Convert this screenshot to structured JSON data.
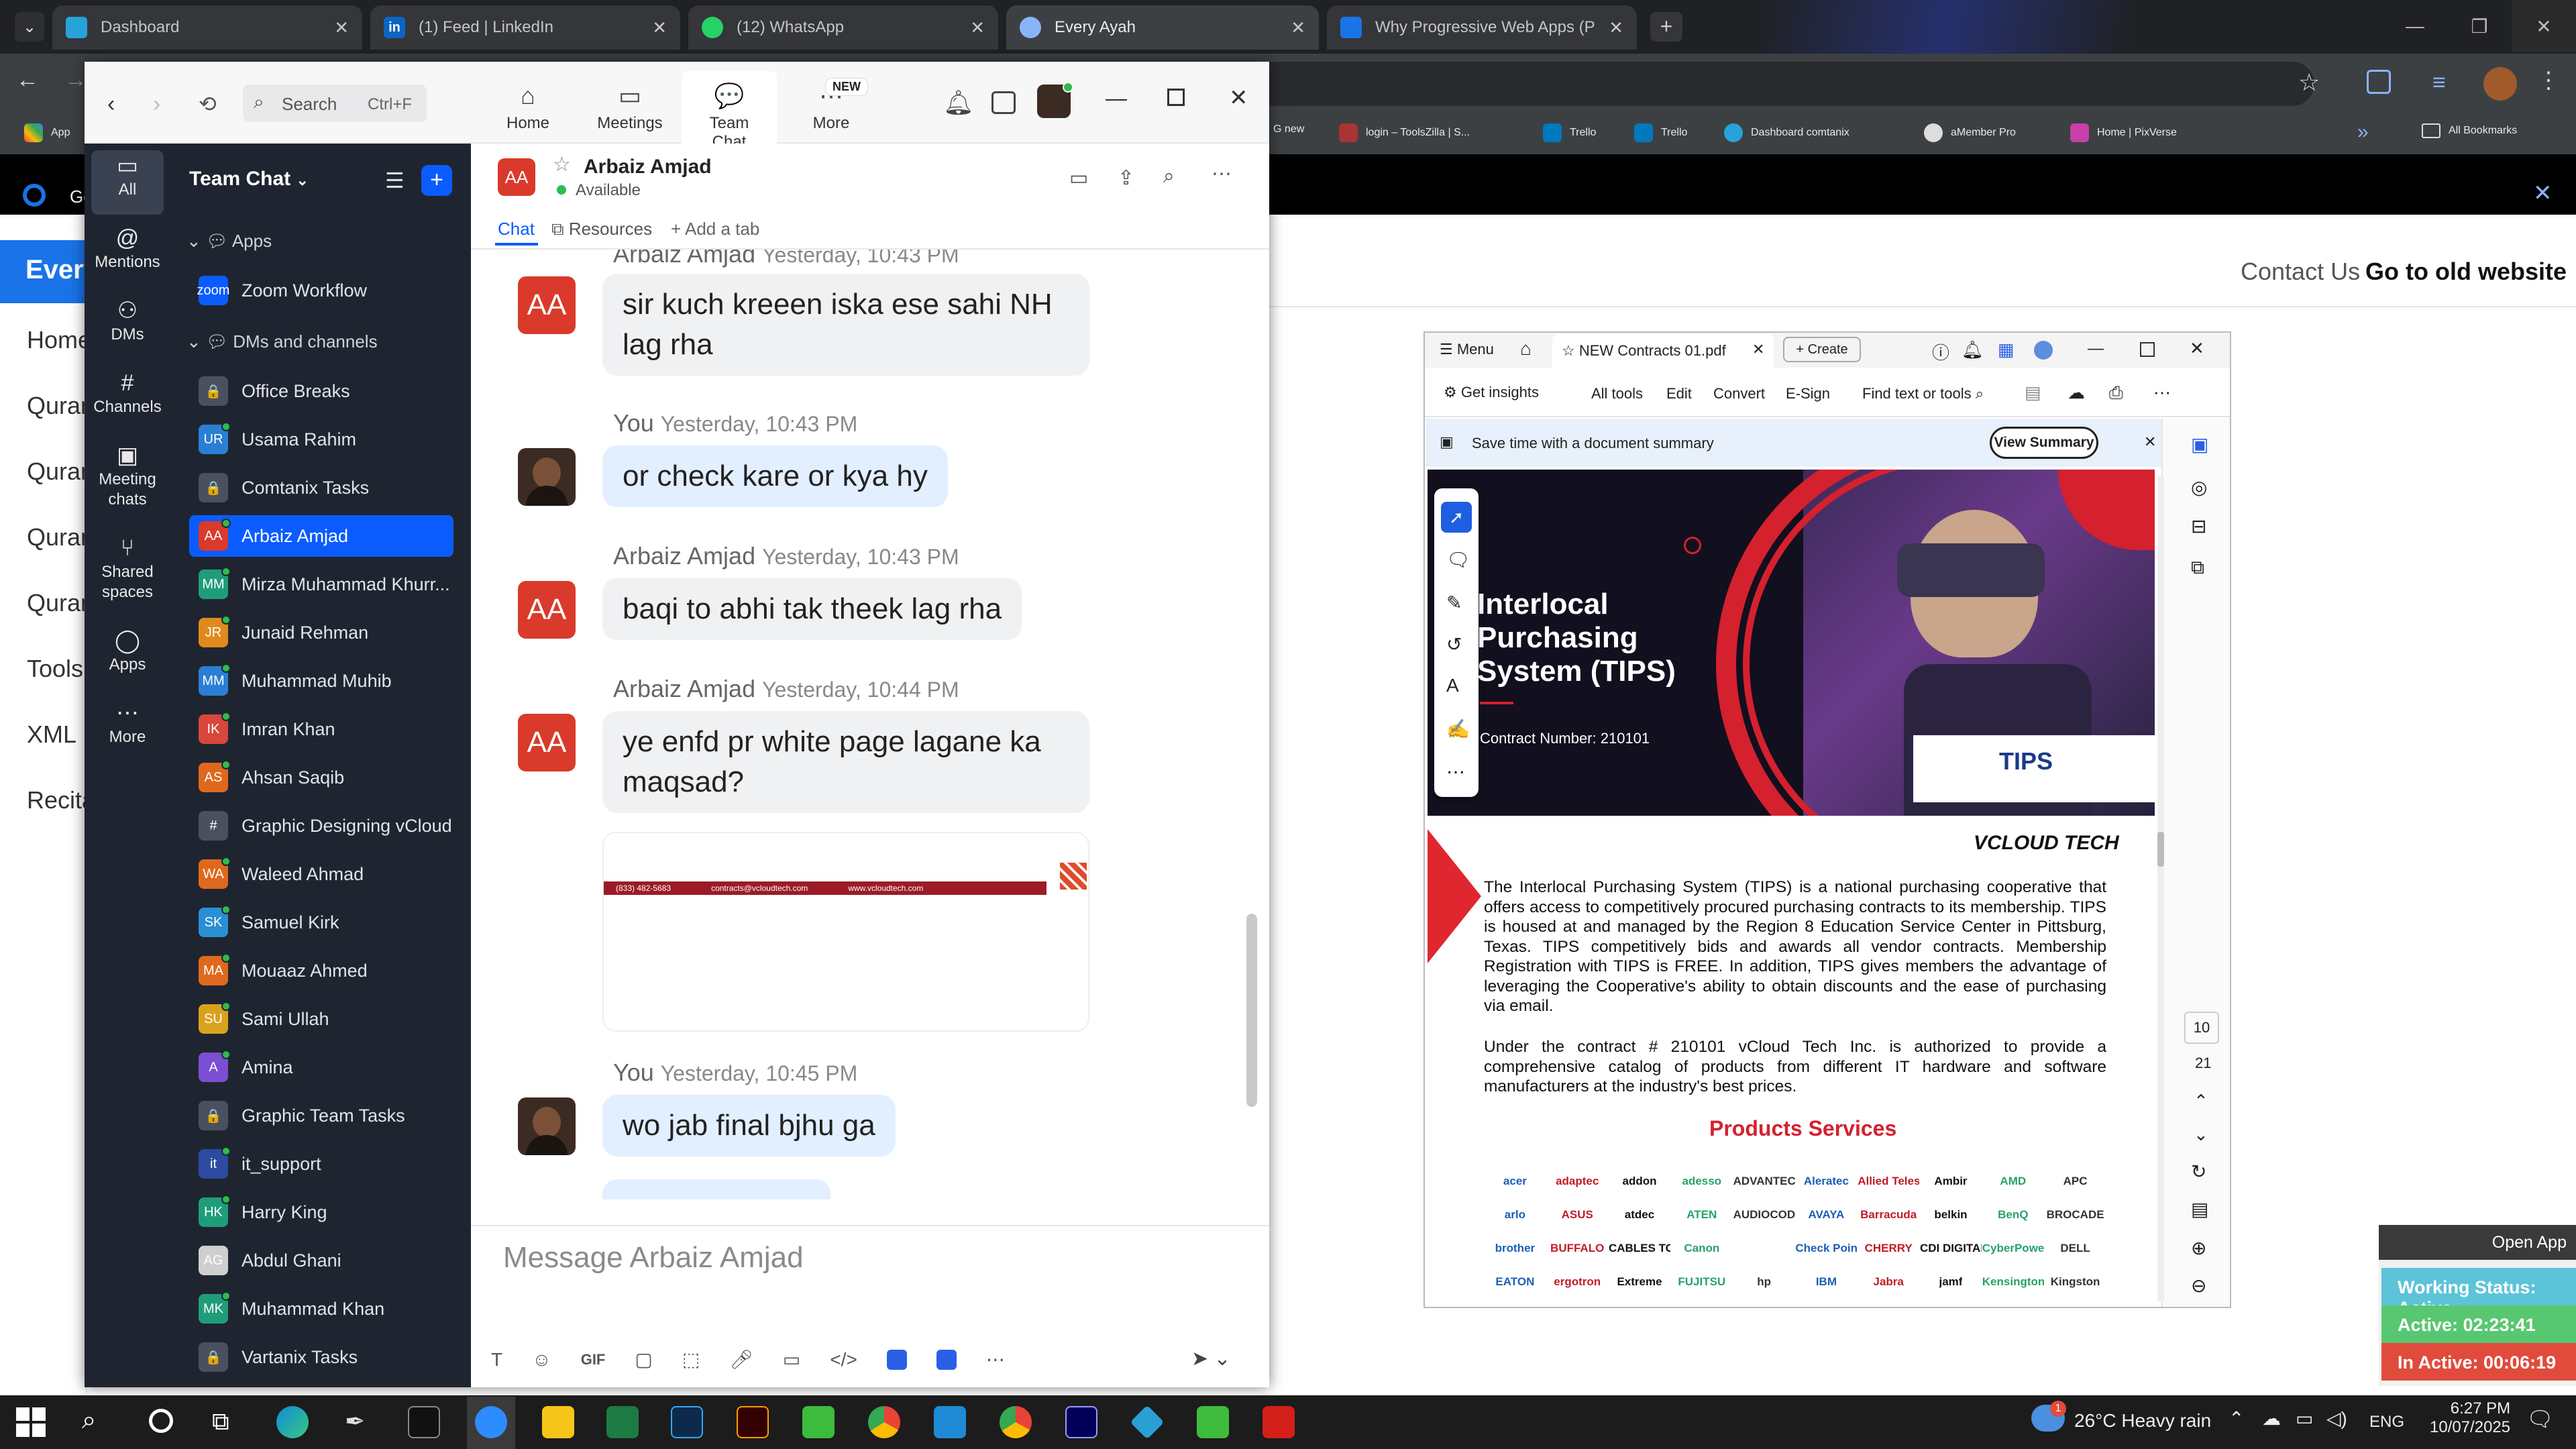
{
  "browser": {
    "tabs": [
      {
        "title": "Dashboard",
        "color": "#27a3d9"
      },
      {
        "title": "(1) Feed | LinkedIn",
        "color": "#0a66c2"
      },
      {
        "title": "(12) WhatsApp",
        "color": "#25d366"
      },
      {
        "title": "Every Ayah",
        "color": "#8ab4f8"
      },
      {
        "title": "Why Progressive Web Apps (PW",
        "color": "#1a73e8"
      }
    ],
    "bookmarks_left": "App",
    "bookmarks": [
      "G new",
      "login – ToolsZilla | S...",
      "Trello",
      "Trello",
      "Dashboard comtanix",
      "aMember Pro",
      "Home | PixVerse"
    ],
    "all_bookmarks": "All Bookmarks"
  },
  "website": {
    "brand": "Every",
    "nav_prefix": "Ge",
    "sidebar": [
      "Home",
      "Quran",
      "Quran",
      "Quran",
      "Quran",
      "Tools",
      "XML",
      "Recita"
    ],
    "contact": "Contact Us",
    "old_site": "Go to old website"
  },
  "zoom": {
    "search_placeholder": "Search",
    "search_shortcut": "Ctrl+F",
    "topnav": [
      {
        "label": "Home",
        "icon": "home-icon"
      },
      {
        "label": "Meetings",
        "icon": "video-icon"
      },
      {
        "label": "Team Chat",
        "icon": "chat-icon"
      },
      {
        "label": "More",
        "icon": "more-icon"
      }
    ],
    "new_badge": "NEW",
    "rail": [
      {
        "label": "All",
        "icon": "chat-bubble-icon"
      },
      {
        "label": "Mentions",
        "icon": "at-icon"
      },
      {
        "label": "DMs",
        "icon": "people-icon"
      },
      {
        "label": "Channels",
        "icon": "hash-icon"
      },
      {
        "label": "Meeting chats",
        "icon": "calendar-icon"
      },
      {
        "label": "Shared spaces",
        "icon": "share-icon"
      },
      {
        "label": "Apps",
        "icon": "apps-icon"
      },
      {
        "label": "More",
        "icon": "ellipsis-icon"
      }
    ],
    "list_title": "Team Chat",
    "sections": {
      "apps": "Apps",
      "dms": "DMs and channels"
    },
    "items": [
      {
        "name": "Zoom Workflow",
        "initials": "zoom",
        "color": "#0b5cff",
        "type": "app"
      },
      {
        "name": "Office Breaks",
        "initials": "🔒",
        "color": "#4a5060",
        "type": "lock"
      },
      {
        "name": "Usama Rahim",
        "initials": "UR",
        "color": "#2a7fd4",
        "type": "user"
      },
      {
        "name": "Comtanix Tasks",
        "initials": "🔒",
        "color": "#4a5060",
        "type": "lock"
      },
      {
        "name": "Arbaiz Amjad",
        "initials": "AA",
        "color": "#d93a2b",
        "type": "user"
      },
      {
        "name": "Mirza Muhammad Khurr...",
        "initials": "MM",
        "color": "#1f9d7a",
        "type": "user"
      },
      {
        "name": "Junaid Rehman",
        "initials": "JR",
        "color": "#e08a1e",
        "type": "user"
      },
      {
        "name": "Muhammad Muhib",
        "initials": "MM",
        "color": "#2a7fd4",
        "type": "user"
      },
      {
        "name": "Imran Khan",
        "initials": "IK",
        "color": "#d9463b",
        "type": "user"
      },
      {
        "name": "Ahsan Saqib",
        "initials": "AS",
        "color": "#e0681e",
        "type": "user"
      },
      {
        "name": "Graphic Designing vCloud",
        "initials": "#",
        "color": "#4a5060",
        "type": "hash"
      },
      {
        "name": "Waleed Ahmad",
        "initials": "WA",
        "color": "#e0681e",
        "type": "user"
      },
      {
        "name": "Samuel Kirk",
        "initials": "SK",
        "color": "#2a8fd4",
        "type": "user"
      },
      {
        "name": "Mouaaz Ahmed",
        "initials": "MA",
        "color": "#e0681e",
        "type": "user"
      },
      {
        "name": "Sami Ullah",
        "initials": "SU",
        "color": "#d9a21e",
        "type": "user"
      },
      {
        "name": "Amina",
        "initials": "A",
        "color": "#7a4fd4",
        "type": "user"
      },
      {
        "name": "Graphic Team Tasks",
        "initials": "🔒",
        "color": "#4a5060",
        "type": "lock"
      },
      {
        "name": "it_support",
        "initials": "it",
        "color": "#2b4aa0",
        "type": "user"
      },
      {
        "name": "Harry King",
        "initials": "HK",
        "color": "#1f9d7a",
        "type": "user"
      },
      {
        "name": "Abdul Ghani",
        "initials": "AG",
        "color": "#cfcfcf",
        "type": "user"
      },
      {
        "name": "Muhammad Khan",
        "initials": "MK",
        "color": "#1f9d7a",
        "type": "user"
      },
      {
        "name": "Vartanix Tasks",
        "initials": "🔒",
        "color": "#4a5060",
        "type": "lock"
      }
    ],
    "chat": {
      "name": "Arbaiz Amjad",
      "status": "Available",
      "tabs": [
        "Chat",
        "Resources",
        "+ Add a tab"
      ],
      "messages": [
        {
          "sender": "Arbaiz Amjad",
          "time": "Yesterday, 10:43 PM",
          "text": "sir kuch kreeen iska ese sahi NH lag rha"
        },
        {
          "sender": "You",
          "time": "Yesterday, 10:43 PM",
          "text": "or check kare or kya hy"
        },
        {
          "sender": "Arbaiz Amjad",
          "time": "Yesterday, 10:43 PM",
          "text": "baqi to abhi tak theek lag rha"
        },
        {
          "sender": "Arbaiz Amjad",
          "time": "Yesterday, 10:44 PM",
          "text": "ye enfd pr white page lagane ka maqsad?"
        },
        {
          "sender": "You",
          "time": "Yesterday, 10:45 PM",
          "text": "wo jab final bjhu ga"
        }
      ],
      "preview_strip": [
        "(833) 482-5683",
        "contracts@vcloudtech.com",
        "www.vcloudtech.com"
      ],
      "composer_placeholder": "Message Arbaiz Amjad",
      "avatar_initials": "AA"
    }
  },
  "acrobat": {
    "menu": "Menu",
    "tab_title": "NEW Contracts 01.pdf",
    "create": "Create",
    "toolbar": [
      "Get insights",
      "All tools",
      "Edit",
      "Convert",
      "E-Sign",
      "Find text or tools"
    ],
    "summary_banner": "Save time with a document summary",
    "view_summary": "View Summary",
    "doc": {
      "title_lines": [
        "Interlocal",
        "Purchasing",
        "System (TIPS)"
      ],
      "contract": "Contract Number: 210101",
      "tips_logo": "TIPS",
      "vcloud_logo": "VCLOUD TECH",
      "para1": "The Interlocal Purchasing System (TIPS) is a national purchasing cooperative that offers access to competitively procured purchasing contracts to its membership. TIPS is housed at and managed by the Region 8 Education Service Center in Pittsburg, Texas. TIPS competitively bids and awards all vendor contracts. Membership Registration with TIPS is FREE. In addition, TIPS gives members the advantage of leveraging the Cooperative's ability to obtain discounts and the ease of purchasing via email.",
      "para2": "Under the contract # 210101 vCloud Tech Inc. is authorized to provide a comprehensive catalog of products from different IT hardware and software manufacturers at the industry's best prices.",
      "products_heading": "Products Services",
      "brands": [
        "acer",
        "adaptec",
        "addon",
        "adesso",
        "ADVANTECH",
        "Aleratec",
        "Allied Telesis",
        "Ambir",
        "AMD",
        "APC",
        "arlo",
        "ASUS",
        "atdec",
        "ATEN",
        "AUDIOCODES",
        "AVAYA",
        "Barracuda",
        "belkin",
        "BenQ",
        "BROCADE",
        "brother",
        "BUFFALO",
        "CABLES TO GO",
        "Canon",
        "",
        "Check Point",
        "CHERRY",
        "CDI DIGITAL",
        "CyberPower",
        "DELL",
        "EATON",
        "ergotron",
        "Extreme",
        "FUJITSU",
        "hp",
        "IBM",
        "Jabra",
        "jamf",
        "Kensington",
        "Kingston"
      ]
    },
    "page_numbers": [
      "10",
      "21"
    ]
  },
  "status_widget": {
    "open_app": "Open App",
    "working": "Working Status: Active",
    "active": "Active: 02:23:41",
    "inactive": "In Active: 00:06:19"
  },
  "taskbar": {
    "weather": "26°C  Heavy rain",
    "weather_badge": "1",
    "lang": "ENG",
    "time": "6:27 PM",
    "date": "10/07/2025"
  }
}
